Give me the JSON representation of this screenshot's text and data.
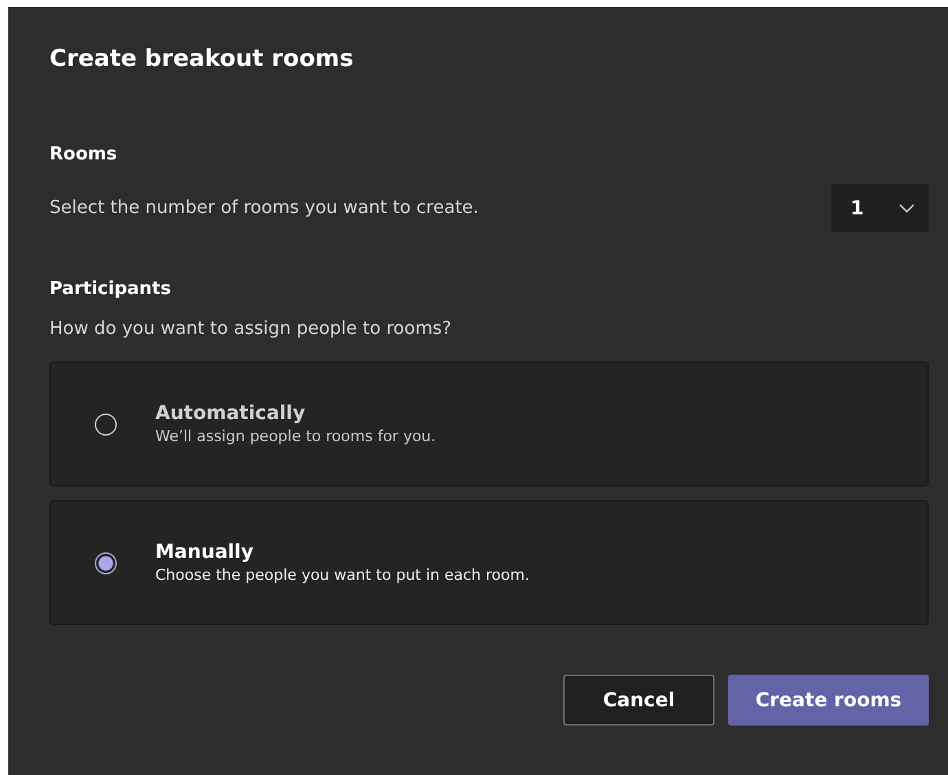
{
  "dialog": {
    "title": "Create breakout rooms"
  },
  "rooms": {
    "label": "Rooms",
    "description": "Select the number of rooms you want to create.",
    "count": "1"
  },
  "participants": {
    "label": "Participants",
    "question": "How do you want to assign people to rooms?",
    "options": [
      {
        "title": "Automatically",
        "description": "We’ll assign people to rooms for you.",
        "selected": false
      },
      {
        "title": "Manually",
        "description": "Choose the people you want to put in each room.",
        "selected": true
      }
    ]
  },
  "buttons": [
    {
      "label": "Cancel",
      "kind": "secondary"
    },
    {
      "label": "Create rooms",
      "kind": "primary"
    }
  ]
}
